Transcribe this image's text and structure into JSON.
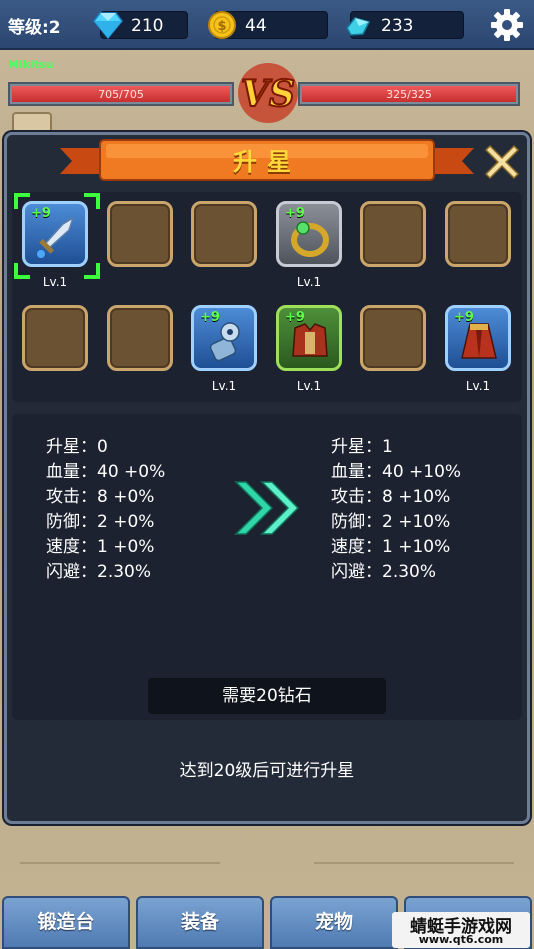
{
  "header": {
    "level_label": "等级:2",
    "diamonds": "210",
    "gold": "44",
    "crystals": "233"
  },
  "battle": {
    "player_name": "Mikitsu",
    "player_hp": "705/705",
    "enemy_hp": "325/325",
    "vs_text": "VS"
  },
  "modal": {
    "title": "升星",
    "slots": [
      {
        "plus": "+9",
        "level": "Lv.1",
        "type": "sword"
      },
      {
        "plus": "",
        "level": "",
        "type": "empty"
      },
      {
        "plus": "",
        "level": "",
        "type": "empty"
      },
      {
        "plus": "+9",
        "level": "Lv.1",
        "type": "ring"
      },
      {
        "plus": "",
        "level": "",
        "type": "empty"
      },
      {
        "plus": "",
        "level": "",
        "type": "empty"
      },
      {
        "plus": "",
        "level": "",
        "type": "empty"
      },
      {
        "plus": "",
        "level": "",
        "type": "empty"
      },
      {
        "plus": "+9",
        "level": "Lv.1",
        "type": "gauntlet"
      },
      {
        "plus": "+9",
        "level": "Lv.1",
        "type": "armor"
      },
      {
        "plus": "",
        "level": "",
        "type": "empty"
      },
      {
        "plus": "+9",
        "level": "Lv.1",
        "type": "cloak"
      }
    ],
    "current_stats": [
      "升星：0",
      "血量：40 +0%",
      "攻击：8 +0%",
      "防御：2 +0%",
      "速度：1 +0%",
      "闪避：2.30%"
    ],
    "next_stats": [
      "升星：1",
      "血量：40 +10%",
      "攻击：8 +10%",
      "防御：2 +10%",
      "速度：1 +10%",
      "闪避：2.30%"
    ],
    "cost_label": "需要20钻石",
    "notice": "达到20级后可进行升星"
  },
  "nav": {
    "forge": "锻造台",
    "equip": "装备",
    "pet": "宠物"
  },
  "watermark": {
    "main": "蜻蜓手游戏网",
    "sub": "www.qt6.com"
  },
  "colors": {
    "accent_gold": "#ffd83a",
    "hp_red": "#e04646",
    "plus_green": "#5dff4a",
    "panel_dark": "#1c2230"
  }
}
